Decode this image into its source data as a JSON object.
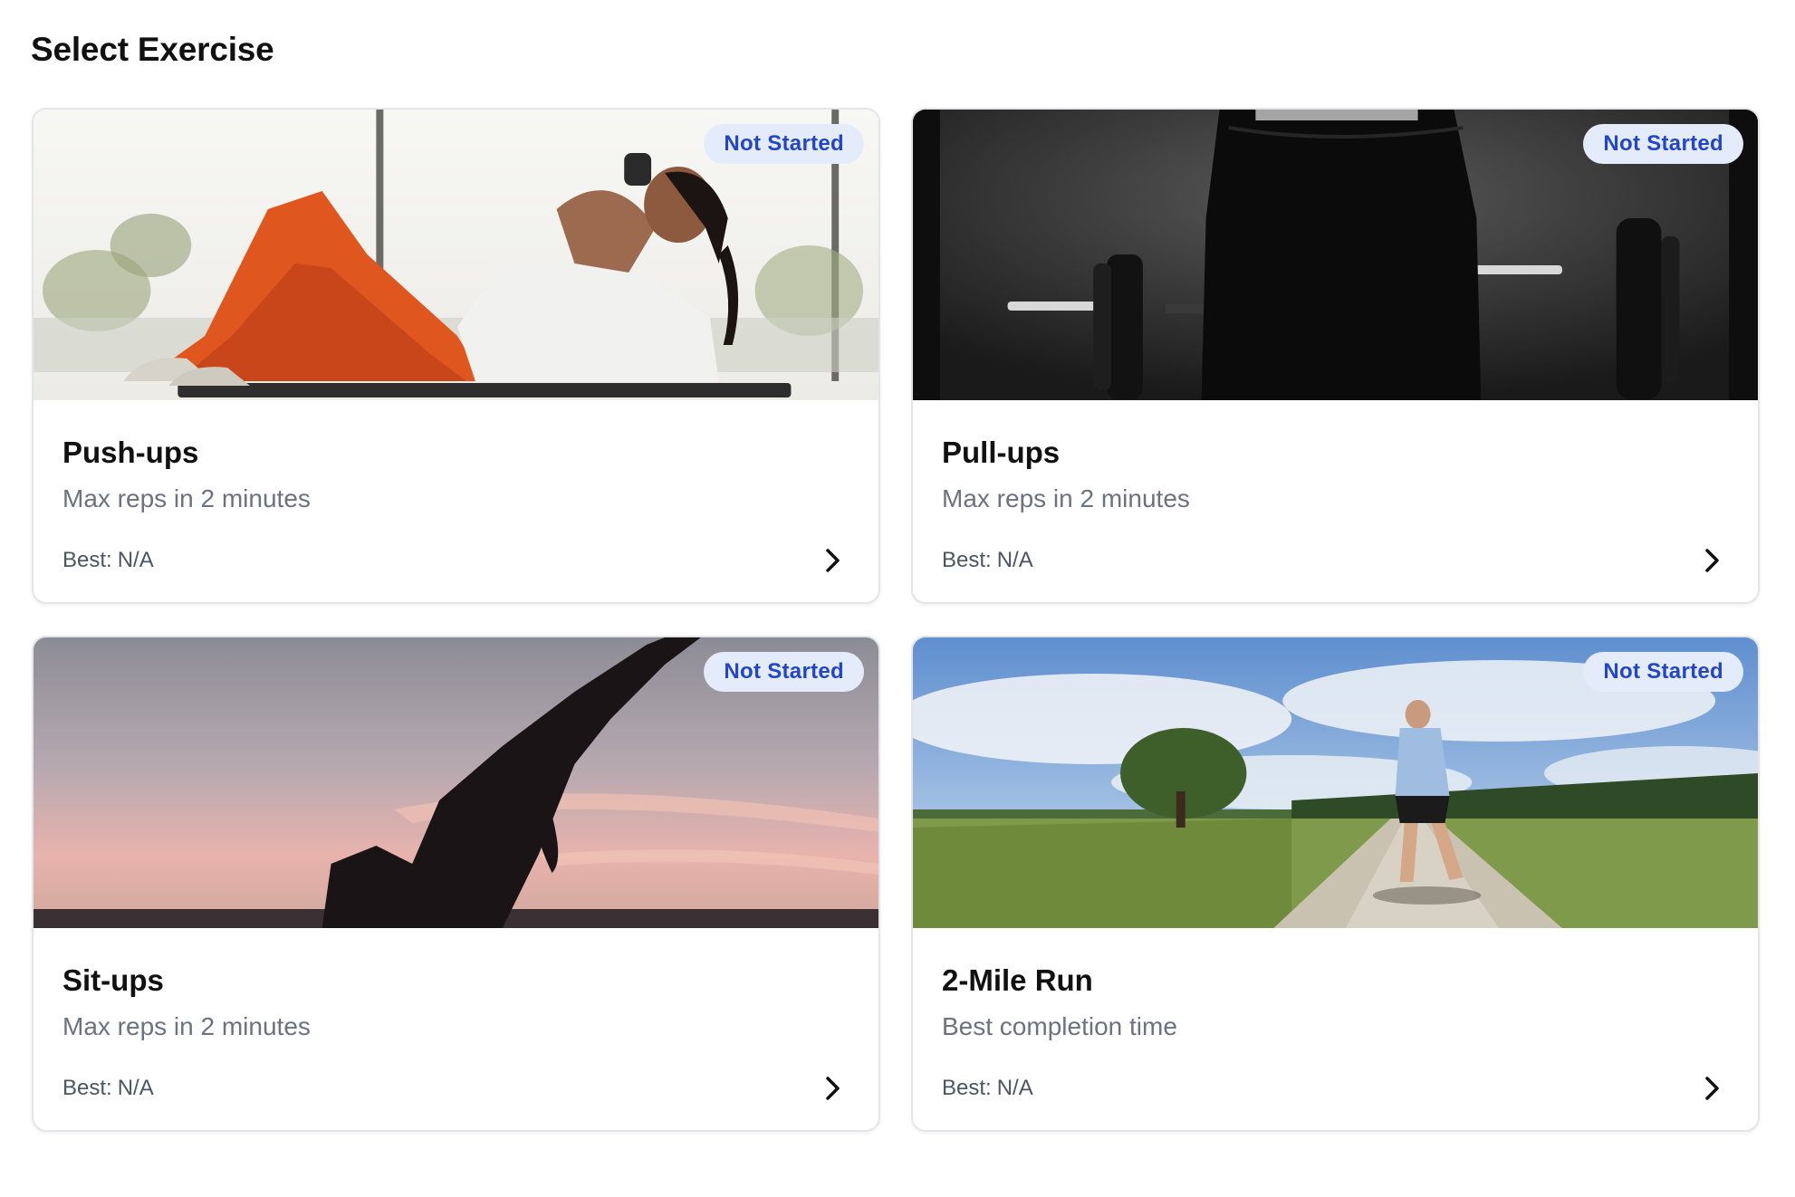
{
  "page": {
    "title": "Select Exercise"
  },
  "exercises": [
    {
      "name": "Push-ups",
      "description": "Max reps in 2 minutes",
      "status": "Not Started",
      "best_label": "Best:",
      "best_value": "N/A",
      "image": "woman-doing-crunches-photo"
    },
    {
      "name": "Pull-ups",
      "description": "Max reps in 2 minutes",
      "status": "Not Started",
      "best_label": "Best:",
      "best_value": "N/A",
      "image": "gym-barbell-black-white-photo"
    },
    {
      "name": "Sit-ups",
      "description": "Max reps in 2 minutes",
      "status": "Not Started",
      "best_label": "Best:",
      "best_value": "N/A",
      "image": "yoga-silhouette-sunset-photo"
    },
    {
      "name": "2-Mile Run",
      "description": "Best completion time",
      "status": "Not Started",
      "best_label": "Best:",
      "best_value": "N/A",
      "image": "runner-on-dirt-road-photo"
    }
  ],
  "colors": {
    "badge_bg": "#e4ebfb",
    "badge_text": "#2346c8",
    "subtitle_text": "#6b7280",
    "card_border": "#e3e5e8"
  }
}
